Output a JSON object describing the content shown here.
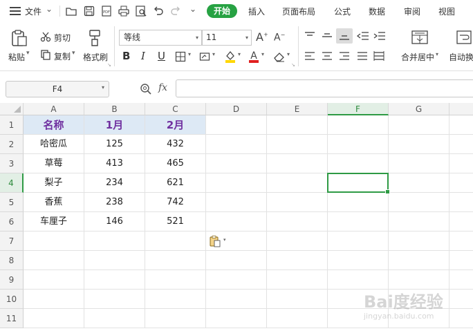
{
  "menubar": {
    "menu_label": "文件",
    "tabs": [
      "开始",
      "插入",
      "页面布局",
      "公式",
      "数据",
      "审阅",
      "视图"
    ]
  },
  "ribbon": {
    "paste_label": "粘贴",
    "cut_label": "剪切",
    "copy_label": "复制",
    "format_painter_label": "格式刷",
    "font_name": "等线",
    "font_size": "11",
    "merge_center_label": "合并居中",
    "autowrap_label": "自动换",
    "font_color": "#e02020",
    "fill_color": "#ffd700"
  },
  "formula_bar": {
    "name_box": "F4",
    "fx_label": "fx",
    "formula_value": ""
  },
  "sheet": {
    "columns": [
      "A",
      "B",
      "C",
      "D",
      "E",
      "F",
      "G"
    ],
    "rows": [
      "1",
      "2",
      "3",
      "4",
      "5",
      "6",
      "7",
      "8",
      "9",
      "10",
      "11"
    ],
    "header": [
      "名称",
      "1月",
      "2月"
    ],
    "data": [
      [
        "哈密瓜",
        "125",
        "432"
      ],
      [
        "草莓",
        "413",
        "465"
      ],
      [
        "梨子",
        "234",
        "621"
      ],
      [
        "香蕉",
        "238",
        "742"
      ],
      [
        "车厘子",
        "146",
        "521"
      ]
    ],
    "selected_cell": "F4"
  },
  "watermark": {
    "brand": "Bai度经验",
    "url": "jingyan.baidu.com"
  }
}
